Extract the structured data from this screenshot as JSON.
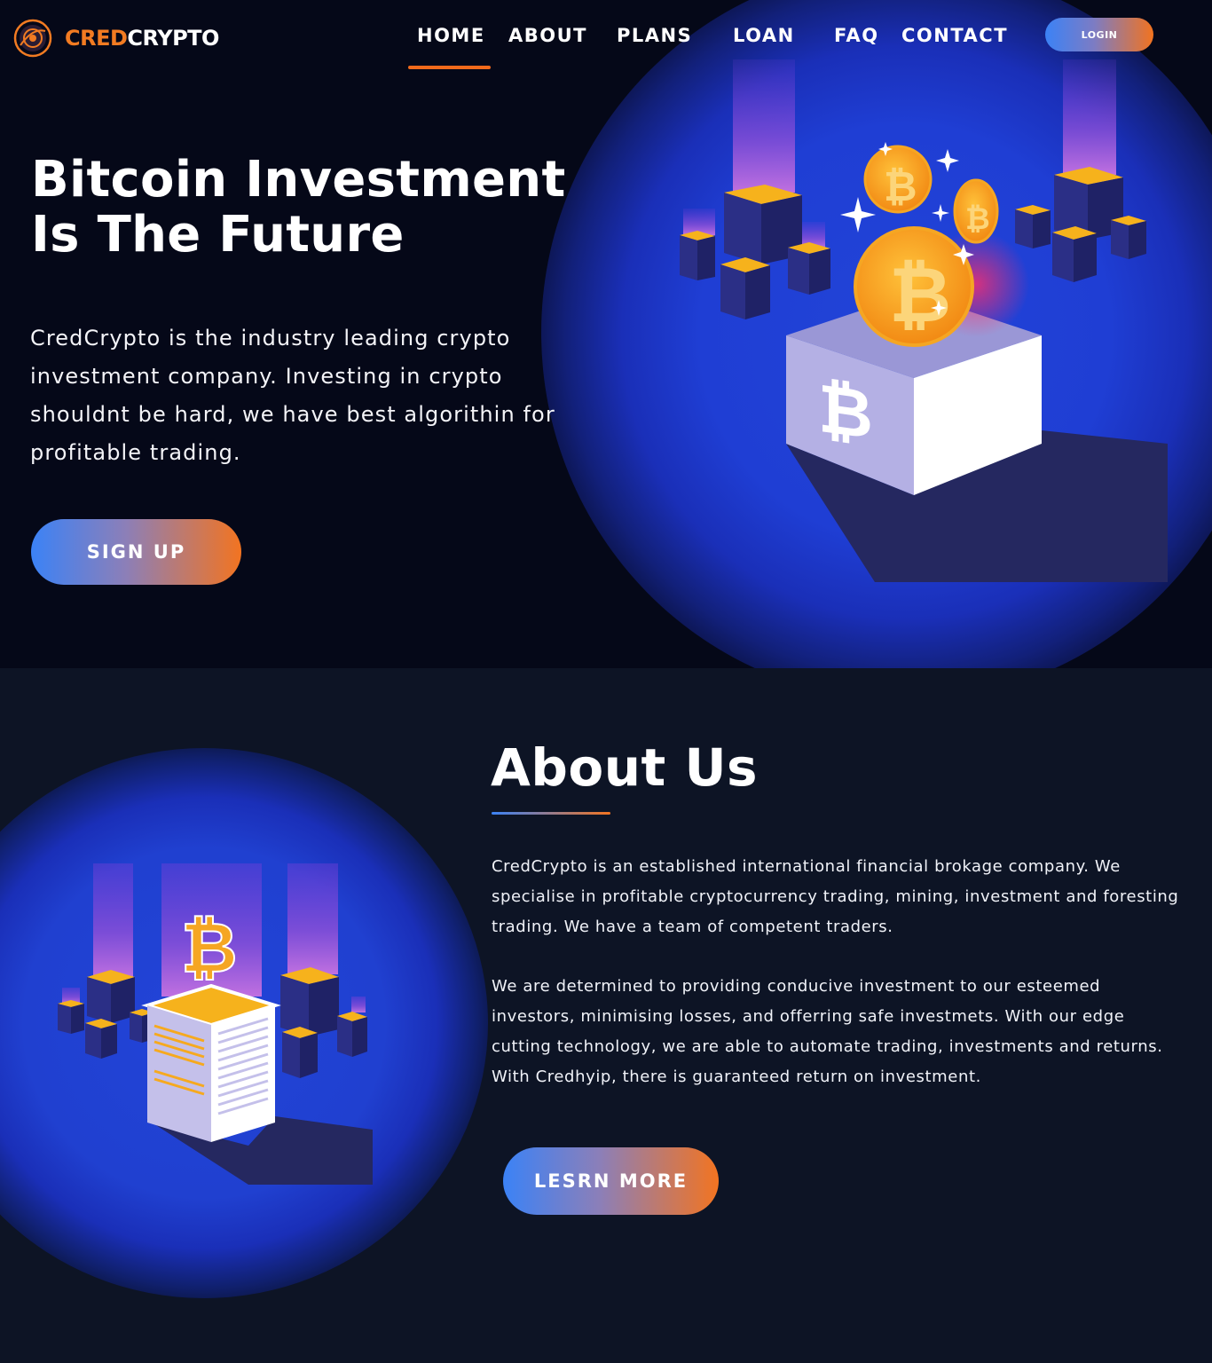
{
  "brand": {
    "name_part1": "CRED",
    "name_part2": "CRYPTO",
    "logo_icon": "bitcoin-logo-icon",
    "accent": "#f27b22"
  },
  "nav": {
    "items": [
      {
        "label": "HOME",
        "active": true
      },
      {
        "label": "ABOUT",
        "active": false
      },
      {
        "label": "PLANS",
        "active": false
      },
      {
        "label": "LOAN",
        "active": false
      },
      {
        "label": "FAQ",
        "active": false
      },
      {
        "label": "CONTACT",
        "active": false
      }
    ],
    "login_label": "LOGIN"
  },
  "hero": {
    "title_line1": "Bitcoin Investment",
    "title_line2": "Is The Future",
    "description": "CredCrypto is the industry leading crypto investment company. Investing in crypto shouldnt be hard, we have best algorithin for profitable trading.",
    "cta_label": "SIGN UP",
    "illustration": "bitcoin-coins-box-illustration"
  },
  "about": {
    "title": "About Us",
    "paragraph1": "CredCrypto is an established international financial brokage company. We specialise in profitable cryptocurrency trading, mining, investment and foresting trading. We have a team of competent traders.",
    "paragraph2": "We are determined to providing conducive investment to our esteemed investors, minimising losses, and offerring safe investmets. With our edge cutting technology, we are able to automate trading, investments and returns. With Credhyip, there is guaranteed return on investment.",
    "cta_label": "LESRN MORE",
    "illustration": "bitcoin-server-illustration"
  },
  "colors": {
    "background": "#050818",
    "about_background": "#0d1425",
    "accent_orange": "#f27421",
    "accent_blue": "#3b82f6",
    "glow_blue": "#2244d8",
    "coin_gold": "#f9a825"
  }
}
